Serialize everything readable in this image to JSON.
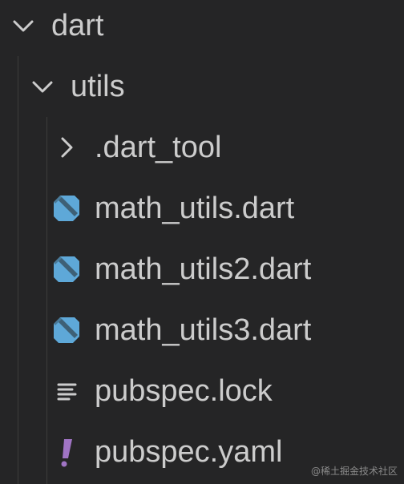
{
  "tree": {
    "root": {
      "label": "dart",
      "icon": "chevron-down-icon"
    },
    "folder": {
      "label": "utils",
      "icon": "chevron-down-icon"
    },
    "items": [
      {
        "label": ".dart_tool",
        "icon": "chevron-right-icon"
      },
      {
        "label": "math_utils.dart",
        "icon": "dart-file-icon"
      },
      {
        "label": "math_utils2.dart",
        "icon": "dart-file-icon"
      },
      {
        "label": "math_utils3.dart",
        "icon": "dart-file-icon"
      },
      {
        "label": "pubspec.lock",
        "icon": "lines-file-icon"
      },
      {
        "label": "pubspec.yaml",
        "icon": "yaml-file-icon"
      }
    ]
  },
  "watermark": "@稀土掘金技术社区",
  "colors": {
    "background": "#252526",
    "text": "#cccccc",
    "dart_icon": "#5ea8d8",
    "yaml_icon": "#a074c4",
    "guide": "#3c3c3c"
  }
}
